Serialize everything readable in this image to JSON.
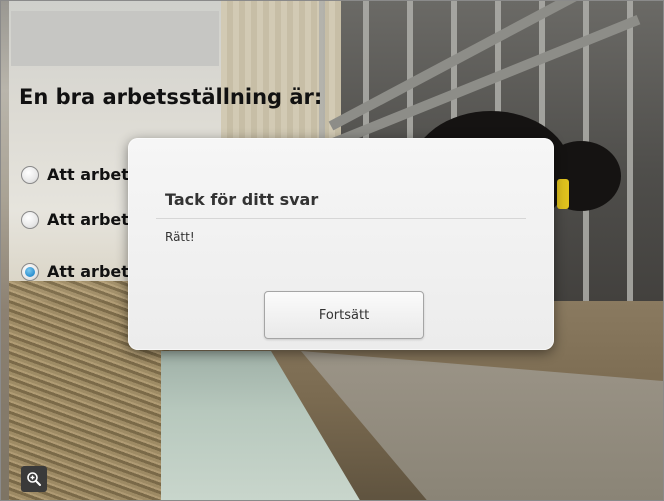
{
  "question": {
    "title": "En bra arbetsställning är:",
    "options": [
      {
        "label": "Att arbet",
        "selected": false
      },
      {
        "label": "Att arbet",
        "selected": false
      },
      {
        "label": "Att arbet",
        "selected": true
      }
    ]
  },
  "dialog": {
    "title": "Tack för ditt svar",
    "message": "Rätt!",
    "continue_label": "Fortsätt"
  },
  "controls": {
    "zoom_icon": "zoom-in-icon"
  },
  "colors": {
    "radio_selected": "#2a8fcf",
    "dialog_bg": "#f2f2f2"
  }
}
